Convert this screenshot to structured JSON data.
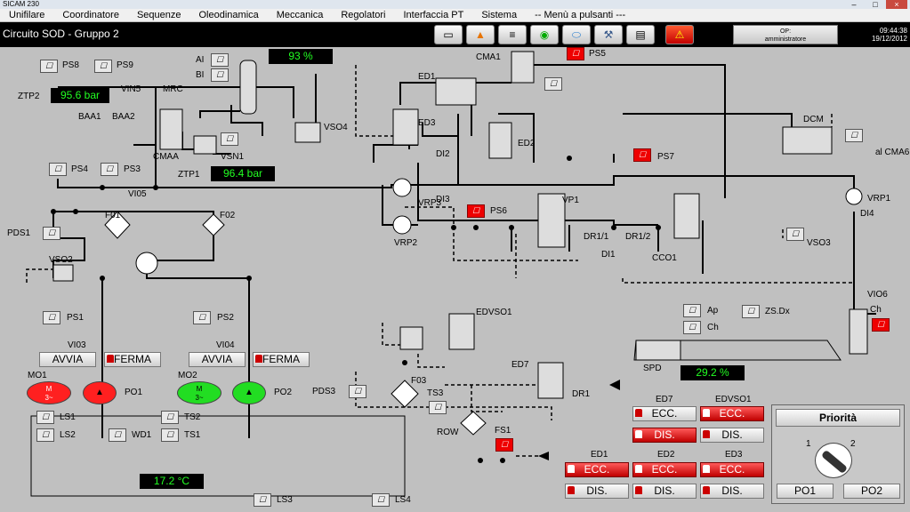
{
  "window": {
    "title": "SICAM 230"
  },
  "menu": [
    "Unifilare",
    "Coordinatore",
    "Sequenze",
    "Oleodinamica",
    "Meccanica",
    "Regolatori",
    "Interfaccia PT",
    "Sistema",
    "-- Menù a pulsanti ---"
  ],
  "header": {
    "circuit_title": "Circuito SOD - Gruppo 2",
    "op_label": "OP:",
    "op_user": "amministratore",
    "time": "09:44:38",
    "date": "19/12/2012"
  },
  "toolbar_icons": [
    "printer-icon",
    "warning-icon",
    "report-icon",
    "radar-icon",
    "disc-icon",
    "wrench-icon",
    "print-icon",
    "alarm-icon"
  ],
  "displays": {
    "level": "93 %",
    "ztp2": "95.6 bar",
    "ztp1": "96.4 bar",
    "pos": "29.2 %",
    "temp": "17.2 °C"
  },
  "labels": {
    "ps8": "PS8",
    "ps9": "PS9",
    "ztp2": "ZTP2",
    "vin5": "VIN5",
    "mrc": "MRC",
    "ai": "AI",
    "bi": "BI",
    "baa1": "BAA1",
    "baa2": "BAA2",
    "cmaa": "CMAA",
    "vsn1": "VSN1",
    "vso4": "VSO4",
    "ztp1": "ZTP1",
    "ps4": "PS4",
    "ps3": "PS3",
    "vi05": "VI05",
    "pds1": "PDS1",
    "f01": "F01",
    "f02": "F02",
    "vso2": "VSO2",
    "ps1": "PS1",
    "ps2": "PS2",
    "vi03": "VI03",
    "vi04": "VI04",
    "mo1": "MO1",
    "mo2": "MO2",
    "po1": "PO1",
    "po2": "PO2",
    "ls1": "LS1",
    "ls2": "LS2",
    "ts2": "TS2",
    "ts1": "TS1",
    "wd1": "WD1",
    "ls3": "LS3",
    "ls4": "LS4",
    "cma1": "CMA1",
    "ps5": "PS5",
    "ed1": "ED1",
    "ed3": "ED3",
    "ed2": "ED2",
    "di2": "DI2",
    "di3": "DI3",
    "vrp3": "VRP3",
    "vrp2": "VRP2",
    "ps6": "PS6",
    "vp1": "VP1",
    "dr1_1": "DR1/1",
    "dr1_2": "DR1/2",
    "di1": "DI1",
    "cco1": "CCO1",
    "ps7": "PS7",
    "dcm": "DCM",
    "al_cma6": "al CMA6",
    "vrp1": "VRP1",
    "di4": "DI4",
    "vso3": "VSO3",
    "vio6": "VIO6",
    "ch": "Ch",
    "ap": "Ap",
    "ch2": "Ch",
    "zs_dx": "ZS.Dx",
    "spd": "SPD",
    "edvso1": "EDVSO1",
    "ed7": "ED7",
    "dr1": "DR1",
    "pds3": "PDS3",
    "f03": "F03",
    "ts3": "TS3",
    "row": "ROW",
    "fs1": "FS1",
    "motor_m": "M",
    "motor_3": "3~"
  },
  "motor_buttons": {
    "start": "AVVIA",
    "stop": "FERMA"
  },
  "valve_panel": {
    "ed7": "ED7",
    "edvso1": "EDVSO1",
    "ed1": "ED1",
    "ed2": "ED2",
    "ed3": "ED3",
    "ecc": "ECC.",
    "dis": "DIS."
  },
  "priority": {
    "title": "Priorità",
    "pos1": "1",
    "pos2": "2",
    "po1": "PO1",
    "po2": "PO2"
  },
  "colors": {
    "display_bg": "#000000",
    "display_fg": "#22ff22",
    "alarm_red": "#e00000",
    "pump_red": "#ff2020",
    "pump_green": "#22dd22"
  },
  "switch_symbol": "☐"
}
